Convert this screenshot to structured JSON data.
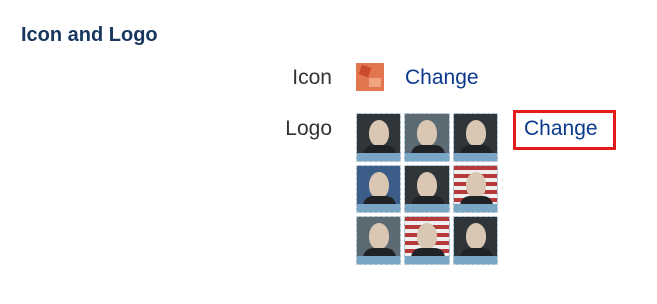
{
  "section": {
    "title": "Icon and Logo"
  },
  "icon_row": {
    "label": "Icon",
    "change_label": "Change"
  },
  "logo_row": {
    "label": "Logo",
    "change_label": "Change"
  },
  "colors": {
    "title": "#17375e",
    "link": "#0b3a8c",
    "highlight_border": "#e31b1b"
  }
}
